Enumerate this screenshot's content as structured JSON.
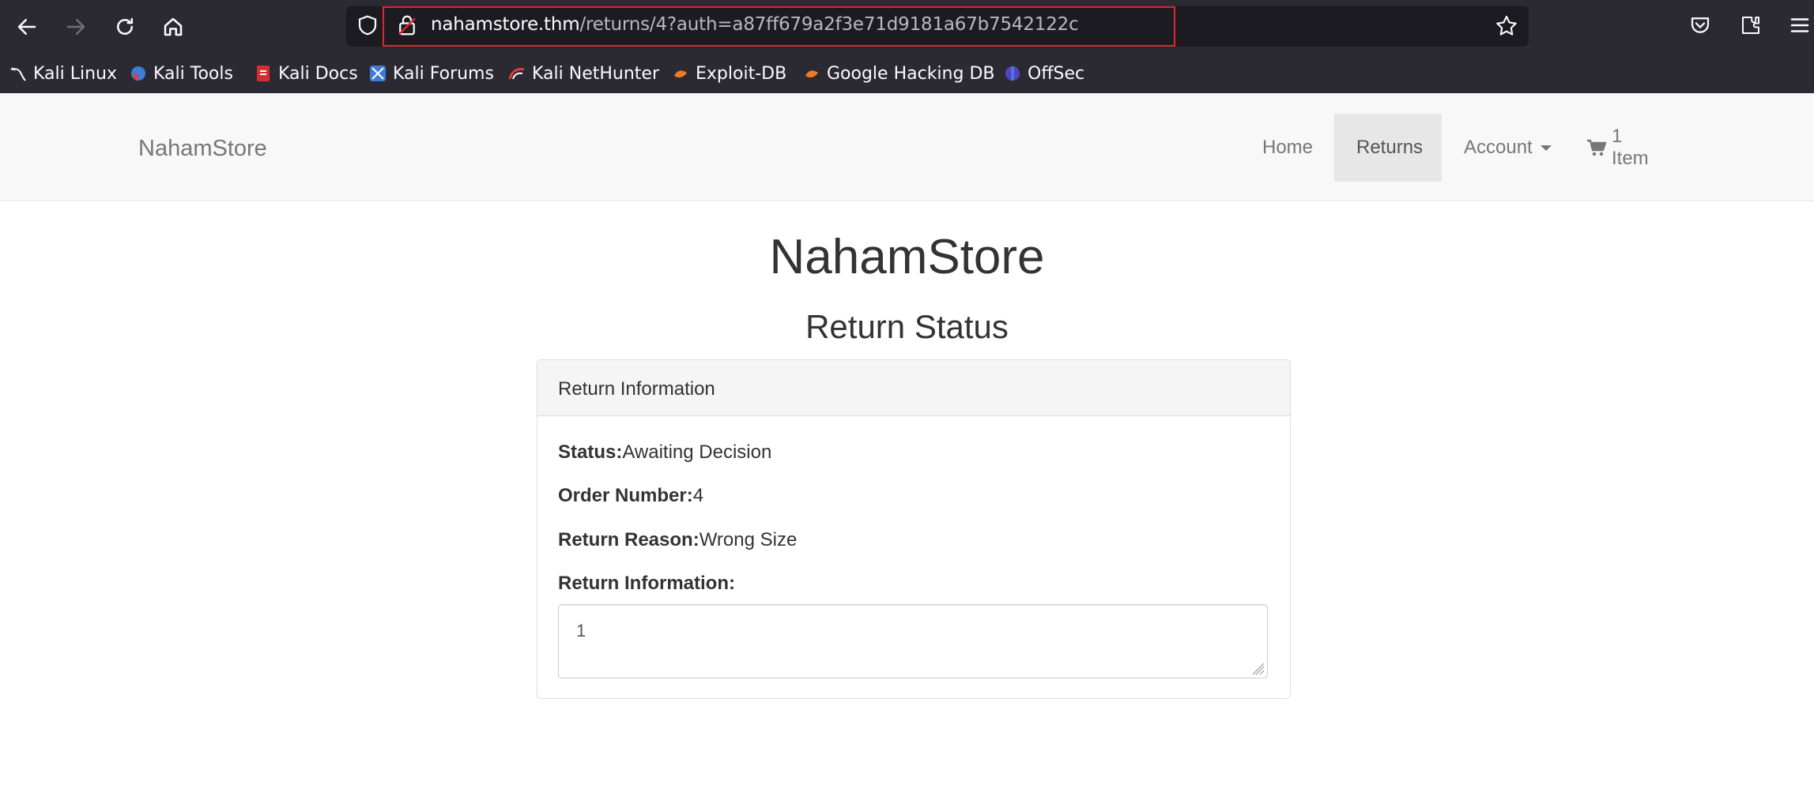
{
  "browser": {
    "url_host": "nahamstore.thm",
    "url_path": "/returns/4?auth=a87ff679a2f3e71d9181a67b7542122c",
    "bookmarks": [
      {
        "label": "Kali Linux",
        "icon": "kali-dragon-icon"
      },
      {
        "label": "Kali Tools",
        "icon": "kali-tools-icon"
      },
      {
        "label": "Kali Docs",
        "icon": "kali-docs-icon"
      },
      {
        "label": "Kali Forums",
        "icon": "kali-forums-icon"
      },
      {
        "label": "Kali NetHunter",
        "icon": "kali-nethunter-icon"
      },
      {
        "label": "Exploit-DB",
        "icon": "exploit-db-icon"
      },
      {
        "label": "Google Hacking DB",
        "icon": "ghdb-icon"
      },
      {
        "label": "OffSec",
        "icon": "offsec-icon"
      }
    ]
  },
  "navbar": {
    "brand": "NahamStore",
    "items": {
      "home": "Home",
      "returns": "Returns",
      "account": "Account",
      "cart": "1 Item"
    }
  },
  "main": {
    "title": "NahamStore",
    "subtitle": "Return Status",
    "panel": {
      "heading": "Return Information",
      "status_label": "Status:",
      "status_value": "Awaiting Decision",
      "order_label": "Order Number:",
      "order_value": "4",
      "reason_label": "Return Reason:",
      "reason_value": "Wrong Size",
      "info_label": "Return Information:",
      "info_value": "1"
    }
  }
}
